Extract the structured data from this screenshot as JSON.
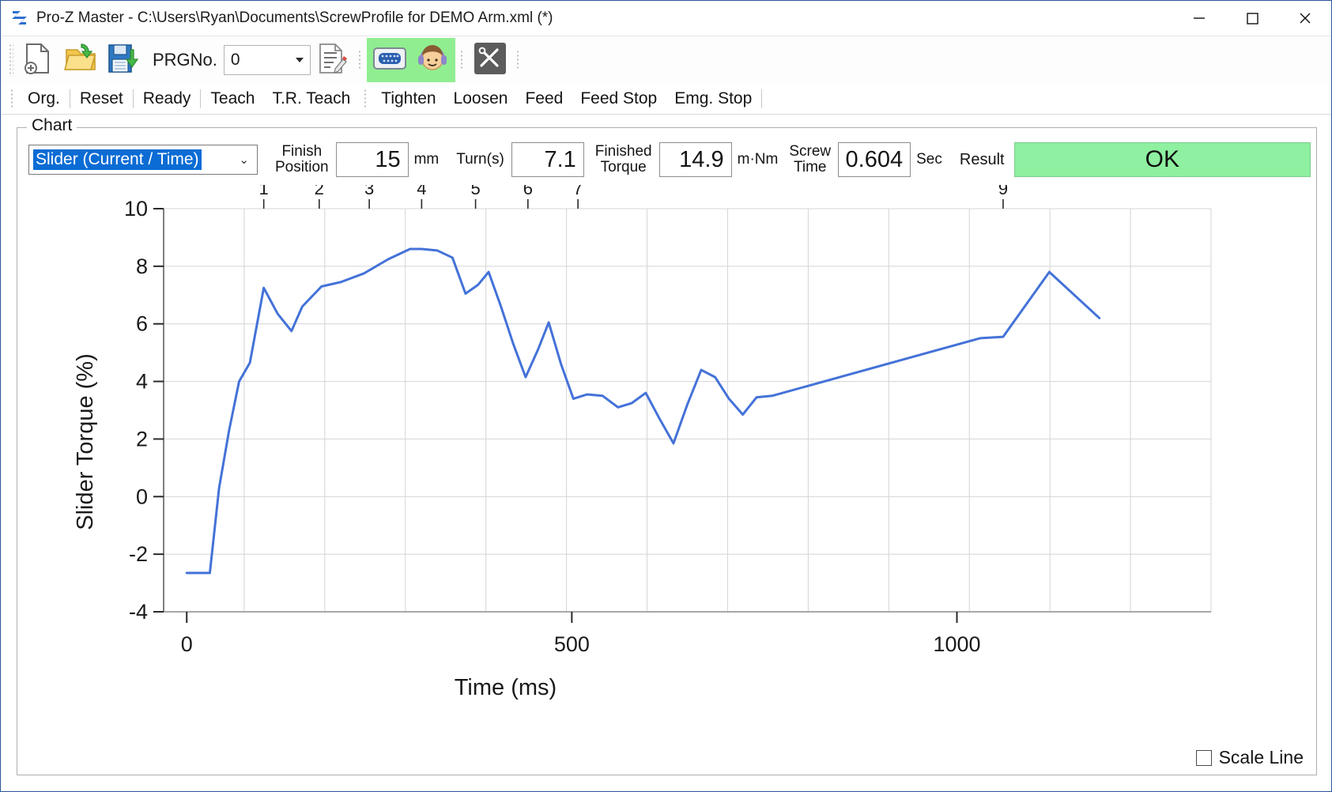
{
  "window": {
    "title": "Pro-Z Master - C:\\Users\\Ryan\\Documents\\ScrewProfile for DEMO Arm.xml (*)",
    "app_icon": "pro-z-logo-icon",
    "minimize": "—",
    "maximize": "☐",
    "close": "✕"
  },
  "toolbar": {
    "new_icon": "new-file-icon",
    "open_icon": "open-folder-icon",
    "save_icon": "save-disk-icon",
    "prg_label": "PRGNo.",
    "prg_value": "0",
    "report_icon": "edit-document-icon",
    "monitor_icon": "connector-port-icon",
    "operator_icon": "operator-headset-icon",
    "tools_icon": "tools-wrench-icon"
  },
  "commands": [
    {
      "label": "Org."
    },
    {
      "label": "Reset"
    },
    {
      "label": "Ready"
    },
    {
      "label": "Teach"
    },
    {
      "label": "T.R. Teach"
    },
    {
      "label": "Tighten"
    },
    {
      "label": "Loosen"
    },
    {
      "label": "Feed"
    },
    {
      "label": "Feed Stop"
    },
    {
      "label": "Emg. Stop"
    }
  ],
  "chart_group": {
    "legend": "Chart",
    "selector_value": "Slider (Current / Time)",
    "chevron": "⌄",
    "scale_line_label": "Scale Line",
    "scale_line_checked": false
  },
  "status_fields": [
    {
      "label_line1": "Finish",
      "label_line2": "Position",
      "value": "15",
      "unit": "mm"
    },
    {
      "label_line1": "Turn(s)",
      "label_line2": "",
      "value": "7.1",
      "unit": ""
    },
    {
      "label_line1": "Finished",
      "label_line2": "Torque",
      "value": "14.9",
      "unit": "m·Nm"
    },
    {
      "label_line1": "Screw",
      "label_line2": "Time",
      "value": "0.604",
      "unit": "Sec"
    }
  ],
  "result": {
    "label": "Result",
    "value": "OK",
    "color": "#8ef0a0"
  },
  "chart_data": {
    "type": "line",
    "title": "",
    "xlabel": "Time (ms)",
    "ylabel": "Slider Torque (%)",
    "xlim": [
      -30,
      1330
    ],
    "ylim": [
      -4,
      10
    ],
    "xticks": [
      0,
      500,
      1000
    ],
    "xticklabels": [
      "0",
      "500",
      "1000"
    ],
    "yticks": [
      -4,
      -2,
      0,
      2,
      4,
      6,
      8,
      10
    ],
    "yticklabels": [
      "-4",
      "-2",
      "0",
      "2",
      "4",
      "6",
      "8",
      "10"
    ],
    "grid": true,
    "legend": "none",
    "line_color": "#4472d8",
    "line_width": 3,
    "top_markers": [
      {
        "label": "1",
        "x": 100
      },
      {
        "label": "2",
        "x": 172
      },
      {
        "label": "3",
        "x": 237
      },
      {
        "label": "4",
        "x": 305
      },
      {
        "label": "5",
        "x": 375
      },
      {
        "label": "6",
        "x": 443
      },
      {
        "label": "7",
        "x": 508
      },
      {
        "label": "9",
        "x": 1060
      }
    ],
    "x": [
      0,
      30,
      42,
      55,
      68,
      82,
      100,
      118,
      136,
      150,
      175,
      200,
      230,
      262,
      290,
      305,
      325,
      345,
      362,
      378,
      392,
      408,
      424,
      440,
      456,
      470,
      486,
      502,
      520,
      540,
      560,
      578,
      596,
      614,
      632,
      650,
      668,
      686,
      704,
      722,
      740,
      760,
      1030,
      1060,
      1120,
      1185
    ],
    "y": [
      -2.65,
      -2.65,
      0.3,
      2.3,
      4.0,
      4.65,
      7.25,
      6.35,
      5.75,
      6.6,
      7.3,
      7.45,
      7.75,
      8.25,
      8.6,
      8.6,
      8.55,
      8.3,
      7.05,
      7.35,
      7.8,
      6.6,
      5.3,
      4.15,
      5.1,
      6.05,
      4.6,
      3.4,
      3.55,
      3.5,
      3.1,
      3.25,
      3.6,
      2.7,
      1.85,
      3.2,
      4.4,
      4.15,
      3.4,
      2.85,
      3.45,
      3.5,
      5.5,
      5.55,
      7.8,
      6.2
    ]
  }
}
